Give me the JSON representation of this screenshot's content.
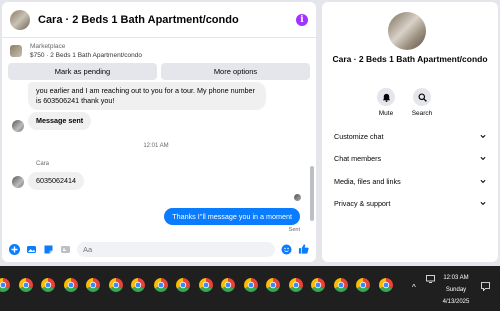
{
  "chat": {
    "title": "Cara · 2 Beds 1 Bath Apartment/condo",
    "listing": {
      "source": "Marketplace",
      "price_title": "$750 · 2 Beds 1 Bath Apartment/condo"
    },
    "actions": {
      "mark_pending": "Mark as pending",
      "more_options": "More options"
    },
    "messages": {
      "partial_text": "you earlier and I am reaching out to you for a tour. My phone number is 603506241 thank you!",
      "system_message": "Message sent",
      "timestamp": "12:01 AM",
      "sender": "Cara",
      "incoming_text": "6035062414",
      "outgoing_text": "Thanks I''ll message you in a moment",
      "status": "Sent"
    },
    "composer": {
      "placeholder": "Aa"
    },
    "accent_color": "#0a7cff"
  },
  "details": {
    "title": "Cara · 2 Beds 1 Bath Apartment/condo",
    "mute_label": "Mute",
    "search_label": "Search",
    "sections": [
      {
        "label": "Customize chat"
      },
      {
        "label": "Chat members"
      },
      {
        "label": "Media, files and links"
      },
      {
        "label": "Privacy & support"
      }
    ]
  },
  "taskbar": {
    "app_icon": "chrome-icon",
    "app_count": 18,
    "time": "12:03 AM",
    "day": "Sunday",
    "date": "4/13/2025"
  }
}
